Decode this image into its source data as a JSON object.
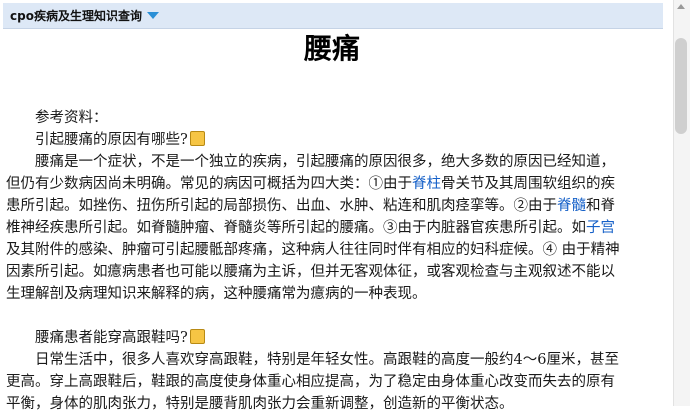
{
  "header": {
    "menu_label": "cpo疾病及生理知识查询"
  },
  "article": {
    "title": "腰痛",
    "lines": [
      "参考资料：",
      "引起腰痛的原因有哪些?",
      "腰痛是一个症状，不是一个独立的疾病，引起腰痛的原因很多，绝大多数的原因已经知道，",
      "但仍有少数病因尚未明确。常见的病因可概括为四大类：①由于",
      "骨关节及其周围软组织的疾",
      "患所引起。如挫伤、扭伤所引起的局部损伤、出血、水肿、粘连和肌肉痉挛等。②由于",
      "和脊",
      "椎神经疾患所引起。如脊髓肿瘤、脊髓炎等所引起的腰痛。③由于内脏器官疾患所引起。如",
      "及其附件的感染、肿瘤可引起腰骶部疼痛，这种病人往往同时伴有相应的妇科症候。④ 由于精神",
      "因素所引起。如癔病患者也可能以腰痛为主诉，但并无客观体征，或客观检查与主观叙述不能以",
      "生理解剖及病理知识来解释的病，这种腰痛常为癔病的一种表现。",
      "腰痛患者能穿高跟鞋吗?",
      "日常生活中，很多人喜欢穿高跟鞋，特别是年轻女性。高跟鞋的高度一般约4～6厘米，甚至",
      "更高。穿上高跟鞋后，鞋跟的高度使身体重心相应提高，为了稳定由身体重心改变而失去的原有",
      "平衡，身体的肌肉张力，特别是腰背肌肉张力会重新调整，创造新的平衡状态。"
    ],
    "links": {
      "spine": "脊柱",
      "spinal_cord": "脊髓",
      "uterus": "子宫"
    }
  },
  "colors": {
    "header_bg": "#dde8f6",
    "caret": "#2a8fd6",
    "link": "#1560c8",
    "spark_icon": "#f6c544"
  }
}
